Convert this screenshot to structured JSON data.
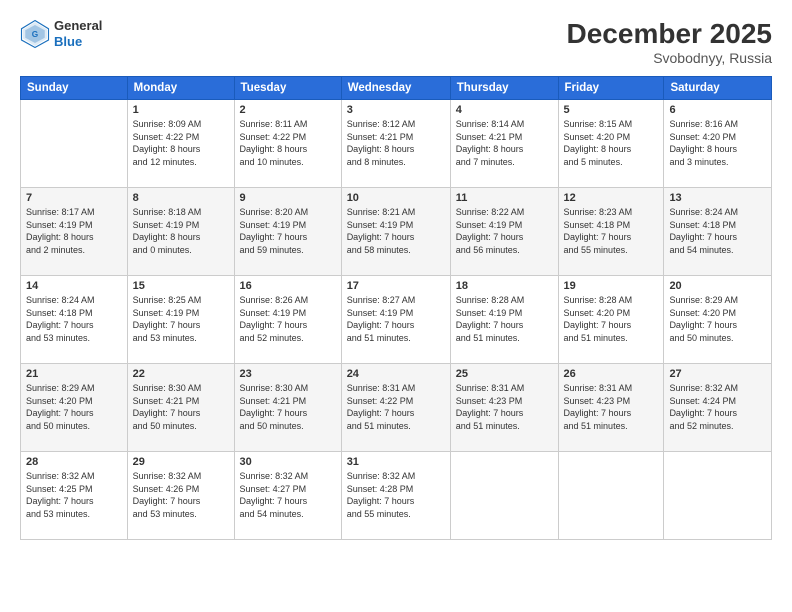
{
  "header": {
    "logo_line1": "General",
    "logo_line2": "Blue",
    "month": "December 2025",
    "location": "Svobodnyy, Russia"
  },
  "columns": [
    "Sunday",
    "Monday",
    "Tuesday",
    "Wednesday",
    "Thursday",
    "Friday",
    "Saturday"
  ],
  "weeks": [
    [
      {
        "day": "",
        "info": ""
      },
      {
        "day": "1",
        "info": "Sunrise: 8:09 AM\nSunset: 4:22 PM\nDaylight: 8 hours\nand 12 minutes."
      },
      {
        "day": "2",
        "info": "Sunrise: 8:11 AM\nSunset: 4:22 PM\nDaylight: 8 hours\nand 10 minutes."
      },
      {
        "day": "3",
        "info": "Sunrise: 8:12 AM\nSunset: 4:21 PM\nDaylight: 8 hours\nand 8 minutes."
      },
      {
        "day": "4",
        "info": "Sunrise: 8:14 AM\nSunset: 4:21 PM\nDaylight: 8 hours\nand 7 minutes."
      },
      {
        "day": "5",
        "info": "Sunrise: 8:15 AM\nSunset: 4:20 PM\nDaylight: 8 hours\nand 5 minutes."
      },
      {
        "day": "6",
        "info": "Sunrise: 8:16 AM\nSunset: 4:20 PM\nDaylight: 8 hours\nand 3 minutes."
      }
    ],
    [
      {
        "day": "7",
        "info": "Sunrise: 8:17 AM\nSunset: 4:19 PM\nDaylight: 8 hours\nand 2 minutes."
      },
      {
        "day": "8",
        "info": "Sunrise: 8:18 AM\nSunset: 4:19 PM\nDaylight: 8 hours\nand 0 minutes."
      },
      {
        "day": "9",
        "info": "Sunrise: 8:20 AM\nSunset: 4:19 PM\nDaylight: 7 hours\nand 59 minutes."
      },
      {
        "day": "10",
        "info": "Sunrise: 8:21 AM\nSunset: 4:19 PM\nDaylight: 7 hours\nand 58 minutes."
      },
      {
        "day": "11",
        "info": "Sunrise: 8:22 AM\nSunset: 4:19 PM\nDaylight: 7 hours\nand 56 minutes."
      },
      {
        "day": "12",
        "info": "Sunrise: 8:23 AM\nSunset: 4:18 PM\nDaylight: 7 hours\nand 55 minutes."
      },
      {
        "day": "13",
        "info": "Sunrise: 8:24 AM\nSunset: 4:18 PM\nDaylight: 7 hours\nand 54 minutes."
      }
    ],
    [
      {
        "day": "14",
        "info": "Sunrise: 8:24 AM\nSunset: 4:18 PM\nDaylight: 7 hours\nand 53 minutes."
      },
      {
        "day": "15",
        "info": "Sunrise: 8:25 AM\nSunset: 4:19 PM\nDaylight: 7 hours\nand 53 minutes."
      },
      {
        "day": "16",
        "info": "Sunrise: 8:26 AM\nSunset: 4:19 PM\nDaylight: 7 hours\nand 52 minutes."
      },
      {
        "day": "17",
        "info": "Sunrise: 8:27 AM\nSunset: 4:19 PM\nDaylight: 7 hours\nand 51 minutes."
      },
      {
        "day": "18",
        "info": "Sunrise: 8:28 AM\nSunset: 4:19 PM\nDaylight: 7 hours\nand 51 minutes."
      },
      {
        "day": "19",
        "info": "Sunrise: 8:28 AM\nSunset: 4:20 PM\nDaylight: 7 hours\nand 51 minutes."
      },
      {
        "day": "20",
        "info": "Sunrise: 8:29 AM\nSunset: 4:20 PM\nDaylight: 7 hours\nand 50 minutes."
      }
    ],
    [
      {
        "day": "21",
        "info": "Sunrise: 8:29 AM\nSunset: 4:20 PM\nDaylight: 7 hours\nand 50 minutes."
      },
      {
        "day": "22",
        "info": "Sunrise: 8:30 AM\nSunset: 4:21 PM\nDaylight: 7 hours\nand 50 minutes."
      },
      {
        "day": "23",
        "info": "Sunrise: 8:30 AM\nSunset: 4:21 PM\nDaylight: 7 hours\nand 50 minutes."
      },
      {
        "day": "24",
        "info": "Sunrise: 8:31 AM\nSunset: 4:22 PM\nDaylight: 7 hours\nand 51 minutes."
      },
      {
        "day": "25",
        "info": "Sunrise: 8:31 AM\nSunset: 4:23 PM\nDaylight: 7 hours\nand 51 minutes."
      },
      {
        "day": "26",
        "info": "Sunrise: 8:31 AM\nSunset: 4:23 PM\nDaylight: 7 hours\nand 51 minutes."
      },
      {
        "day": "27",
        "info": "Sunrise: 8:32 AM\nSunset: 4:24 PM\nDaylight: 7 hours\nand 52 minutes."
      }
    ],
    [
      {
        "day": "28",
        "info": "Sunrise: 8:32 AM\nSunset: 4:25 PM\nDaylight: 7 hours\nand 53 minutes."
      },
      {
        "day": "29",
        "info": "Sunrise: 8:32 AM\nSunset: 4:26 PM\nDaylight: 7 hours\nand 53 minutes."
      },
      {
        "day": "30",
        "info": "Sunrise: 8:32 AM\nSunset: 4:27 PM\nDaylight: 7 hours\nand 54 minutes."
      },
      {
        "day": "31",
        "info": "Sunrise: 8:32 AM\nSunset: 4:28 PM\nDaylight: 7 hours\nand 55 minutes."
      },
      {
        "day": "",
        "info": ""
      },
      {
        "day": "",
        "info": ""
      },
      {
        "day": "",
        "info": ""
      }
    ]
  ]
}
